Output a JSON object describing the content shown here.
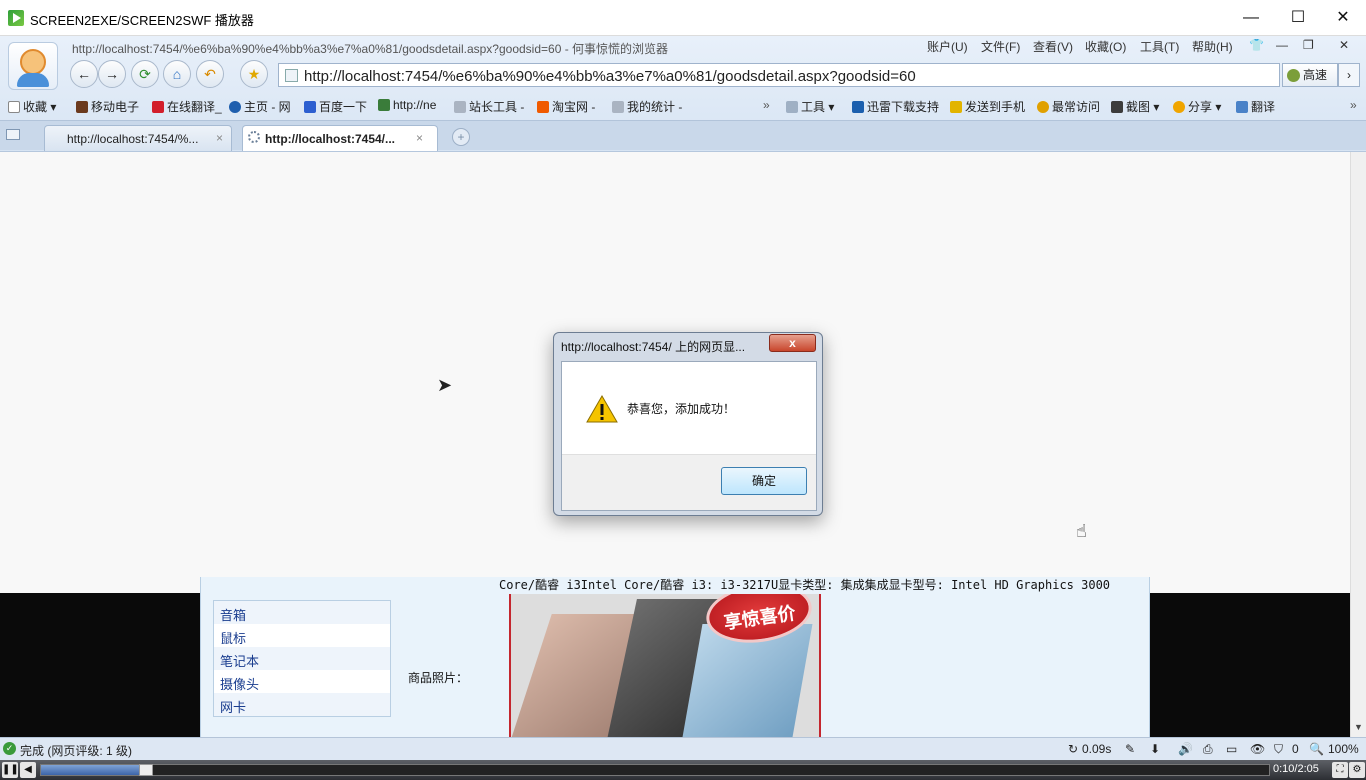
{
  "window": {
    "title": "SCREEN2EXE/SCREEN2SWF 播放器",
    "minimize": "—",
    "maximize": "☐",
    "close": "✕"
  },
  "browser": {
    "page_title": "http://localhost:7454/%e6%ba%90%e4%bb%a3%e7%a0%81/goodsdetail.aspx?goodsid=60 - 何事惊慌的浏览器",
    "menus": [
      "账户(U)",
      "文件(F)",
      "查看(V)",
      "收藏(O)",
      "工具(T)",
      "帮助(H)"
    ],
    "address": "http://localhost:7454/%e6%ba%90%e4%bb%a3%e7%a0%81/goodsdetail.aspx?goodsid=60",
    "speed_label": "高速",
    "favorites": [
      "收藏",
      "移动电子",
      "在线翻译_",
      "主页 - 网",
      "百度一下",
      "http://ne",
      "站长工具 -",
      "淘宝网 -",
      "我的统计 -"
    ],
    "right_tools": [
      "工具",
      "迅雷下载支持",
      "发送到手机",
      "最常访问",
      "截图",
      "分享",
      "翻译"
    ],
    "tabs": [
      {
        "label": "http://localhost:7454/%...",
        "active": false
      },
      {
        "label": "http://localhost:7454/...",
        "active": true
      }
    ],
    "tab_close": "×"
  },
  "page": {
    "specs_line1": "Core/酷睿 i3Intel Core/酷睿 i3: i3-3217U显卡类型: 集成集成显卡型号: Intel HD Graphics 3000",
    "categories": [
      "音箱",
      "鼠标",
      "笔记本",
      "摄像头",
      "网卡"
    ],
    "photo_label": "商品照片：",
    "photo_badge": "享惊喜价"
  },
  "dialog": {
    "title": "http://localhost:7454/ 上的网页显...",
    "message": "恭喜您，添加成功！",
    "ok_label": "确定",
    "close_glyph": "x"
  },
  "status": {
    "left_text": "完成 (网页评级: 1 级)",
    "time": "0.09s",
    "count": "0",
    "zoom": "100%"
  },
  "player": {
    "time": "0:10/2:05",
    "progress": 0.08
  }
}
